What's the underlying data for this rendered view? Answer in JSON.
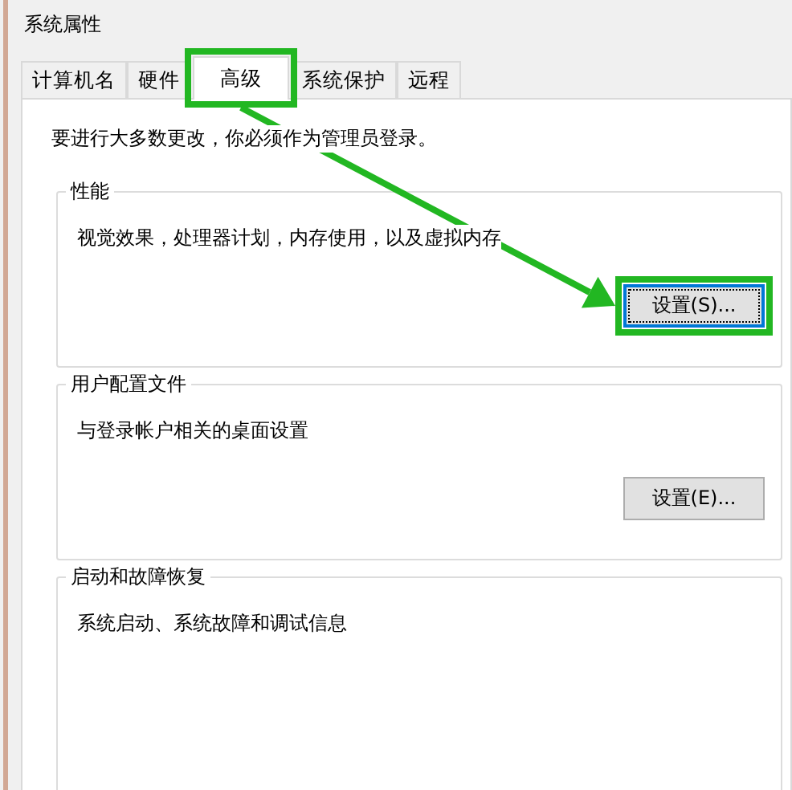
{
  "window": {
    "title": "系统属性"
  },
  "tabs": [
    {
      "label": "计算机名",
      "selected": false
    },
    {
      "label": "硬件",
      "selected": false
    },
    {
      "label": "高级",
      "selected": true
    },
    {
      "label": "系统保护",
      "selected": false
    },
    {
      "label": "远程",
      "selected": false
    }
  ],
  "notice": "要进行大多数更改，你必须作为管理员登录。",
  "groups": [
    {
      "title": "性能",
      "description": "视觉效果，处理器计划，内存使用，以及虚拟内存",
      "button": "设置(S)...",
      "focused": true
    },
    {
      "title": "用户配置文件",
      "description": "与登录帐户相关的桌面设置",
      "button": "设置(E)...",
      "focused": false
    },
    {
      "title": "启动和故障恢复",
      "description": "系统启动、系统故障和调试信息"
    }
  ]
}
